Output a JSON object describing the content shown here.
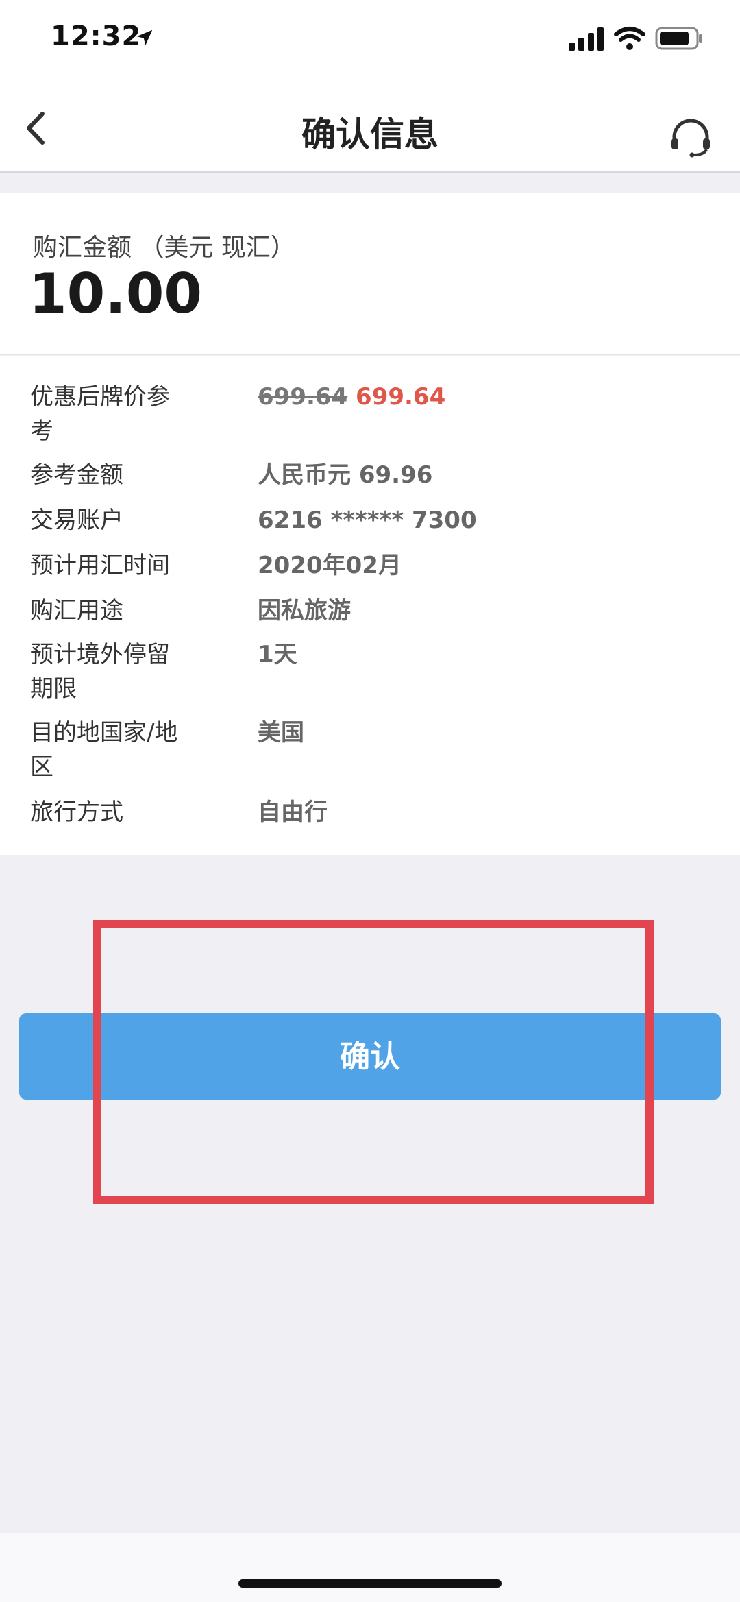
{
  "status_bar": {
    "time": "12:32",
    "icons": [
      "location-arrow-icon",
      "signal-icon",
      "wifi-icon",
      "battery-icon"
    ]
  },
  "nav": {
    "title": "确认信息",
    "back_icon": "chevron-left-icon",
    "service_icon": "headset-icon"
  },
  "amount": {
    "label": "购汇金额 （美元 现汇）",
    "value": "10.00"
  },
  "details": [
    {
      "label": "优惠后牌价参考",
      "value_original": "699.64",
      "value_discount": "699.64"
    },
    {
      "label": "参考金额",
      "value": "人民币元 69.96"
    },
    {
      "label": "交易账户",
      "value": "6216 ****** 7300"
    },
    {
      "label": "预计用汇时间",
      "value": "2020年02月"
    },
    {
      "label": "购汇用途",
      "value": "因私旅游"
    },
    {
      "label": "预计境外停留期限",
      "value": "1天"
    },
    {
      "label": "目的地国家/地区",
      "value": "美国"
    },
    {
      "label": "旅行方式",
      "value": "自由行"
    }
  ],
  "confirm_button": {
    "label": "确认"
  },
  "colors": {
    "primary_blue": "#4fa3e6",
    "discount_red": "#e0574a",
    "highlight_red": "#e2454f"
  }
}
